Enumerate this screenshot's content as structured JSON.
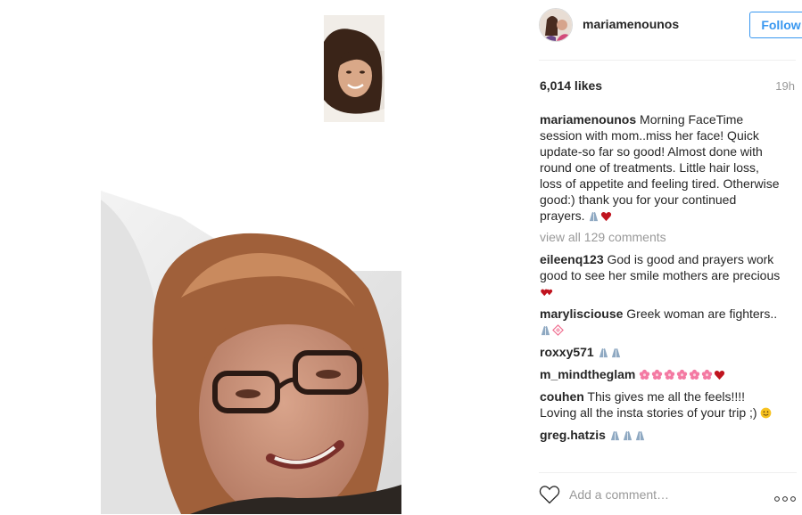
{
  "post": {
    "username": "mariamenounos",
    "follow_label": "Follow",
    "likes": "6,014 likes",
    "time": "19h",
    "caption_user": "mariamenounos",
    "caption_text": " Morning FaceTime session with mom..miss her face! Quick update-so far so good! Almost done with round one of treatments. Little hair loss, loss of appetite and feeling tired. Otherwise good:) thank you for your continued prayers. ",
    "view_all": "view all 129 comments"
  },
  "comments": [
    {
      "user": "eileenq123",
      "text": " God is good and prayers work good to see her smile mothers are precious "
    },
    {
      "user": "maryliscious​e",
      "text": " Greek woman are fighters.."
    },
    {
      "user": "roxxy571",
      "text": " "
    },
    {
      "user": "m_mindtheglam",
      "text": " "
    },
    {
      "user": "couhen",
      "text": " This gives me all the feels!!!! Loving all the insta stories of your trip ;) "
    },
    {
      "user": "greg.hatzis",
      "text": " "
    }
  ],
  "add_comment": {
    "placeholder": "Add a comment…"
  },
  "icons": [
    "heart-outline-icon",
    "more-options-icon",
    "praying-hands-emoji",
    "red-heart-emoji",
    "two-hearts-emoji",
    "cherry-blossom-emoji",
    "smiling-face-emoji",
    "diamond-emoji"
  ],
  "colors": {
    "accent": "#3897f0",
    "text": "#262626",
    "muted": "#999999",
    "heart": "#c0141f",
    "blossom": "#f47aa3"
  }
}
